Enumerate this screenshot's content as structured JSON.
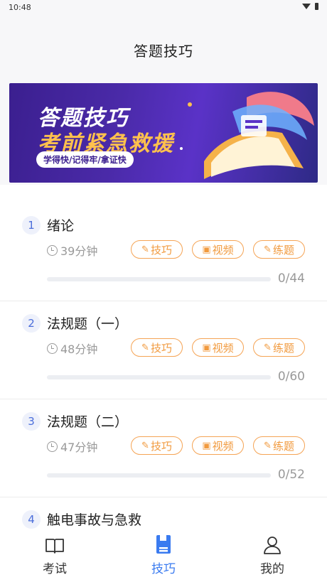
{
  "status": {
    "time": "10:48"
  },
  "header": {
    "title": "答题技巧"
  },
  "banner": {
    "line1": "答题技巧",
    "line2": "考前紧急救援",
    "pill": "学得快/记得牢/拿证快"
  },
  "tag_labels": {
    "skill": "技巧",
    "video": "视频",
    "practice": "练题"
  },
  "items": [
    {
      "num": "1",
      "name": "绪论",
      "duration": "39分钟",
      "progress_text": "0/44",
      "progress": 0
    },
    {
      "num": "2",
      "name": "法规题（一）",
      "duration": "48分钟",
      "progress_text": "0/60",
      "progress": 0
    },
    {
      "num": "3",
      "name": "法规题（二）",
      "duration": "47分钟",
      "progress_text": "0/52",
      "progress": 0
    },
    {
      "num": "4",
      "name": "触电事故与急救"
    }
  ],
  "tabbar": {
    "tabs": [
      {
        "label": "考试",
        "icon": "book-open-icon"
      },
      {
        "label": "技巧",
        "icon": "notebook-icon",
        "active": true
      },
      {
        "label": "我的",
        "icon": "user-icon"
      }
    ],
    "accent": "#3a7bf0"
  },
  "colors": {
    "tag": "#f19a3e",
    "number": "#4b6edb",
    "banner_bg": "#3b1f8f"
  }
}
